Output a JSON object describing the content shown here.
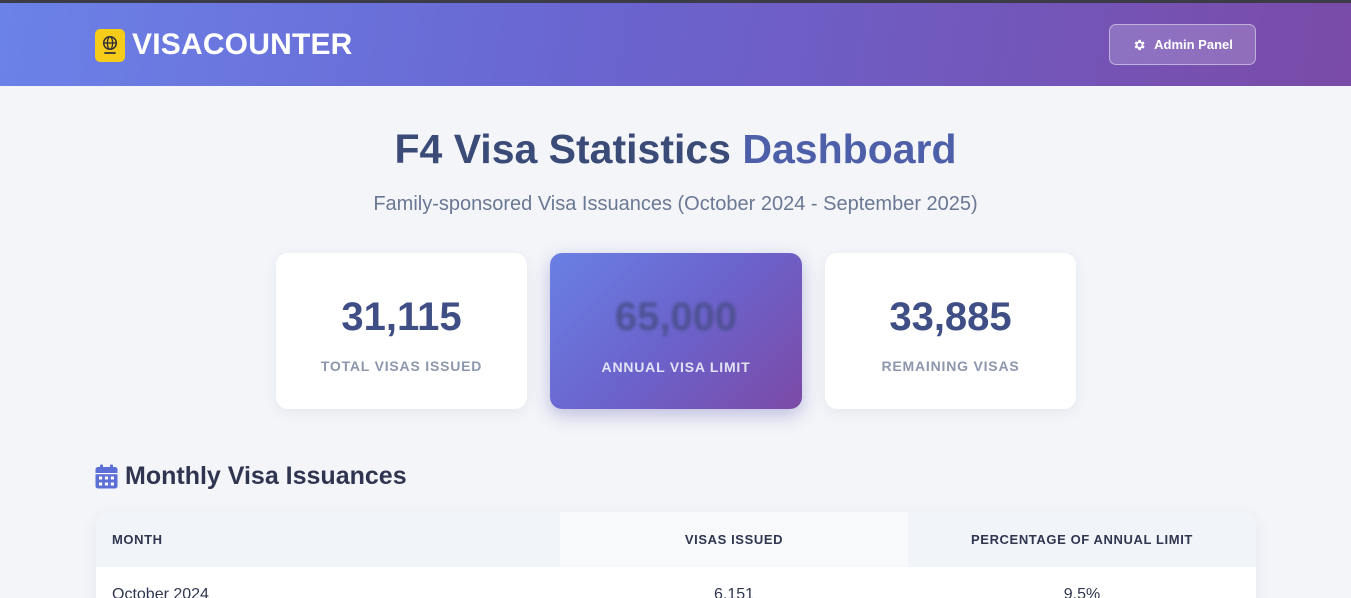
{
  "header": {
    "brand": "VISACOUNTER",
    "admin_button": "Admin Panel"
  },
  "hero": {
    "title_part1": "F4 Visa Statistics",
    "title_part2": "Dashboard",
    "subtitle": "Family-sponsored Visa Issuances (October 2024 - September 2025)"
  },
  "stats": [
    {
      "value": "31,115",
      "label": "TOTAL VISAS ISSUED"
    },
    {
      "value": "65,000",
      "label": "ANNUAL VISA LIMIT"
    },
    {
      "value": "33,885",
      "label": "REMAINING VISAS"
    }
  ],
  "monthly": {
    "title": "Monthly Visa Issuances",
    "columns": [
      "MONTH",
      "VISAS ISSUED",
      "PERCENTAGE OF ANNUAL LIMIT"
    ],
    "rows": [
      {
        "month": "October 2024",
        "visas": "6,151",
        "percent": "9.5%"
      }
    ]
  },
  "colors": {
    "header_start": "#6b82e8",
    "header_end": "#7a4ba8",
    "logo_badge": "#f5cc1a",
    "title": "#3b4b78",
    "accent": "#4d5fa8"
  },
  "icons": {
    "logo": "passport-globe-icon",
    "admin": "gear-icon",
    "section": "calendar-icon"
  }
}
